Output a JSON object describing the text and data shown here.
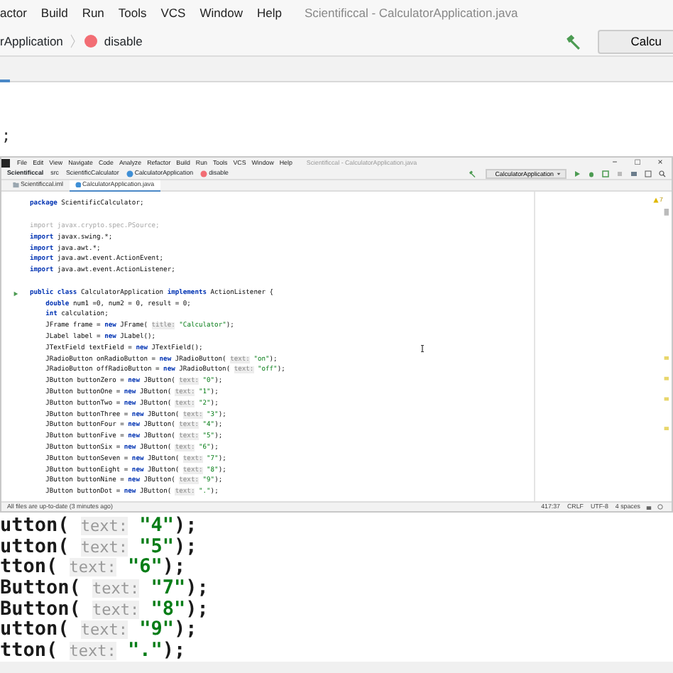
{
  "main_window": {
    "menu": [
      "actor",
      "Build",
      "Run",
      "Tools",
      "VCS",
      "Window",
      "Help"
    ],
    "title": "Scientificcal - CalculatorApplication.java",
    "breadcrumbs": [
      {
        "kind": "text",
        "text": "rApplication"
      },
      {
        "kind": "method",
        "text": "disable"
      }
    ],
    "run_config": "Calcu",
    "line_fragment": ";",
    "code": [
      {
        "segments": [
          {
            "kind": "plain",
            "text": "utton( "
          },
          {
            "kind": "hint",
            "text": "text:"
          },
          {
            "kind": "string",
            "text": " \"4\""
          },
          {
            "kind": "plain",
            "text": ");"
          }
        ]
      },
      {
        "segments": [
          {
            "kind": "plain",
            "text": "utton( "
          },
          {
            "kind": "hint",
            "text": "text:"
          },
          {
            "kind": "string",
            "text": " \"5\""
          },
          {
            "kind": "plain",
            "text": ");"
          }
        ]
      },
      {
        "segments": [
          {
            "kind": "plain",
            "text": "tton( "
          },
          {
            "kind": "hint",
            "text": "text:"
          },
          {
            "kind": "string",
            "text": " \"6\""
          },
          {
            "kind": "plain",
            "text": ");"
          }
        ]
      },
      {
        "segments": [
          {
            "kind": "plain",
            "text": "Button( "
          },
          {
            "kind": "hint",
            "text": "text:"
          },
          {
            "kind": "string",
            "text": " \"7\""
          },
          {
            "kind": "plain",
            "text": ");"
          }
        ]
      },
      {
        "segments": [
          {
            "kind": "plain",
            "text": "Button( "
          },
          {
            "kind": "hint",
            "text": "text:"
          },
          {
            "kind": "string",
            "text": " \"8\""
          },
          {
            "kind": "plain",
            "text": ");"
          }
        ]
      },
      {
        "segments": [
          {
            "kind": "plain",
            "text": "utton( "
          },
          {
            "kind": "hint",
            "text": "text:"
          },
          {
            "kind": "string",
            "text": " \"9\""
          },
          {
            "kind": "plain",
            "text": ");"
          }
        ]
      },
      {
        "segments": [
          {
            "kind": "plain",
            "text": "tton( "
          },
          {
            "kind": "hint",
            "text": "text:"
          },
          {
            "kind": "string",
            "text": " \".\""
          },
          {
            "kind": "plain",
            "text": ");"
          }
        ]
      }
    ]
  },
  "inner_window": {
    "menu": [
      "File",
      "Edit",
      "View",
      "Navigate",
      "Code",
      "Analyze",
      "Refactor",
      "Build",
      "Run",
      "Tools",
      "VCS",
      "Window",
      "Help"
    ],
    "title": "Scientificcal - CalculatorApplication.java",
    "window_controls": [
      "−",
      "□",
      "×"
    ],
    "breadcrumbs": [
      {
        "kind": "text",
        "text": "Scientificcal"
      },
      {
        "kind": "text",
        "text": "src"
      },
      {
        "kind": "text",
        "text": "ScientificCalculator"
      },
      {
        "kind": "class",
        "text": "CalculatorApplication"
      },
      {
        "kind": "method",
        "text": "disable"
      }
    ],
    "run_config": "CalculatorApplication",
    "tabs": [
      {
        "kind": "module",
        "label": "Scientificcal.iml",
        "selected": false
      },
      {
        "kind": "class",
        "label": "CalculatorApplication.java",
        "selected": true
      }
    ],
    "warnings": "7",
    "code": [
      {
        "kind": "code",
        "run_marker": false,
        "segments": [
          {
            "kind": "keyword",
            "text": "package "
          },
          {
            "kind": "plain",
            "text": "ScientificCalculator;"
          }
        ]
      },
      {
        "kind": "blank"
      },
      {
        "kind": "code",
        "run_marker": false,
        "segments": [
          {
            "kind": "unused",
            "text": "import javax.crypto.spec.PSource;"
          }
        ]
      },
      {
        "kind": "code",
        "run_marker": false,
        "segments": [
          {
            "kind": "keyword",
            "text": "import "
          },
          {
            "kind": "plain",
            "text": "javax.swing.*;"
          }
        ]
      },
      {
        "kind": "code",
        "run_marker": false,
        "segments": [
          {
            "kind": "keyword",
            "text": "import "
          },
          {
            "kind": "plain",
            "text": "java.awt.*;"
          }
        ]
      },
      {
        "kind": "code",
        "run_marker": false,
        "segments": [
          {
            "kind": "keyword",
            "text": "import "
          },
          {
            "kind": "plain",
            "text": "java.awt.event.ActionEvent;"
          }
        ]
      },
      {
        "kind": "code",
        "run_marker": false,
        "segments": [
          {
            "kind": "keyword",
            "text": "import "
          },
          {
            "kind": "plain",
            "text": "java.awt.event.ActionListener;"
          }
        ]
      },
      {
        "kind": "blank"
      },
      {
        "kind": "code",
        "run_marker": true,
        "segments": [
          {
            "kind": "keyword",
            "text": "public class "
          },
          {
            "kind": "plain",
            "text": "CalculatorApplication "
          },
          {
            "kind": "keyword",
            "text": "implements "
          },
          {
            "kind": "plain",
            "text": "ActionListener {"
          }
        ]
      },
      {
        "kind": "code",
        "run_marker": false,
        "segments": [
          {
            "kind": "keyword",
            "text": "    double "
          },
          {
            "kind": "plain",
            "text": "num1 =0, num2 = 0, result = 0;"
          }
        ]
      },
      {
        "kind": "code",
        "run_marker": false,
        "segments": [
          {
            "kind": "keyword",
            "text": "    int "
          },
          {
            "kind": "plain",
            "text": "calculation;"
          }
        ]
      },
      {
        "kind": "code",
        "run_marker": false,
        "segments": [
          {
            "kind": "plain",
            "text": "    JFrame frame = "
          },
          {
            "kind": "keyword",
            "text": "new "
          },
          {
            "kind": "plain",
            "text": "JFrame( "
          },
          {
            "kind": "hint",
            "text": "title:"
          },
          {
            "kind": "string",
            "text": " \"Calculator\""
          },
          {
            "kind": "plain",
            "text": ");"
          }
        ]
      },
      {
        "kind": "code",
        "run_marker": false,
        "segments": [
          {
            "kind": "plain",
            "text": "    JLabel label = "
          },
          {
            "kind": "keyword",
            "text": "new "
          },
          {
            "kind": "plain",
            "text": "JLabel();"
          }
        ]
      },
      {
        "kind": "code",
        "run_marker": false,
        "segments": [
          {
            "kind": "plain",
            "text": "    JTextField textField = "
          },
          {
            "kind": "keyword",
            "text": "new "
          },
          {
            "kind": "plain",
            "text": "JTextField();"
          }
        ]
      },
      {
        "kind": "code",
        "run_marker": false,
        "segments": [
          {
            "kind": "plain",
            "text": "    JRadioButton onRadioButton = "
          },
          {
            "kind": "keyword",
            "text": "new "
          },
          {
            "kind": "plain",
            "text": "JRadioButton( "
          },
          {
            "kind": "hint",
            "text": "text:"
          },
          {
            "kind": "string",
            "text": " \"on\""
          },
          {
            "kind": "plain",
            "text": ");"
          }
        ]
      },
      {
        "kind": "code",
        "run_marker": false,
        "segments": [
          {
            "kind": "plain",
            "text": "    JRadioButton offRadioButton = "
          },
          {
            "kind": "keyword",
            "text": "new "
          },
          {
            "kind": "plain",
            "text": "JRadioButton( "
          },
          {
            "kind": "hint",
            "text": "text:"
          },
          {
            "kind": "string",
            "text": " \"off\""
          },
          {
            "kind": "plain",
            "text": ");"
          }
        ]
      },
      {
        "kind": "code",
        "run_marker": false,
        "segments": [
          {
            "kind": "plain",
            "text": "    JButton buttonZero = "
          },
          {
            "kind": "keyword",
            "text": "new "
          },
          {
            "kind": "plain",
            "text": "JButton( "
          },
          {
            "kind": "hint",
            "text": "text:"
          },
          {
            "kind": "string",
            "text": " \"0\""
          },
          {
            "kind": "plain",
            "text": ");"
          }
        ]
      },
      {
        "kind": "code",
        "run_marker": false,
        "segments": [
          {
            "kind": "plain",
            "text": "    JButton buttonOne = "
          },
          {
            "kind": "keyword",
            "text": "new "
          },
          {
            "kind": "plain",
            "text": "JButton( "
          },
          {
            "kind": "hint",
            "text": "text:"
          },
          {
            "kind": "string",
            "text": " \"1\""
          },
          {
            "kind": "plain",
            "text": ");"
          }
        ]
      },
      {
        "kind": "code",
        "run_marker": false,
        "segments": [
          {
            "kind": "plain",
            "text": "    JButton buttonTwo = "
          },
          {
            "kind": "keyword",
            "text": "new "
          },
          {
            "kind": "plain",
            "text": "JButton( "
          },
          {
            "kind": "hint",
            "text": "text:"
          },
          {
            "kind": "string",
            "text": " \"2\""
          },
          {
            "kind": "plain",
            "text": ");"
          }
        ]
      },
      {
        "kind": "code",
        "run_marker": false,
        "segments": [
          {
            "kind": "plain",
            "text": "    JButton buttonThree = "
          },
          {
            "kind": "keyword",
            "text": "new "
          },
          {
            "kind": "plain",
            "text": "JButton( "
          },
          {
            "kind": "hint",
            "text": "text:"
          },
          {
            "kind": "string",
            "text": " \"3\""
          },
          {
            "kind": "plain",
            "text": ");"
          }
        ]
      },
      {
        "kind": "code",
        "run_marker": false,
        "segments": [
          {
            "kind": "plain",
            "text": "    JButton buttonFour = "
          },
          {
            "kind": "keyword",
            "text": "new "
          },
          {
            "kind": "plain",
            "text": "JButton( "
          },
          {
            "kind": "hint",
            "text": "text:"
          },
          {
            "kind": "string",
            "text": " \"4\""
          },
          {
            "kind": "plain",
            "text": ");"
          }
        ]
      },
      {
        "kind": "code",
        "run_marker": false,
        "segments": [
          {
            "kind": "plain",
            "text": "    JButton buttonFive = "
          },
          {
            "kind": "keyword",
            "text": "new "
          },
          {
            "kind": "plain",
            "text": "JButton( "
          },
          {
            "kind": "hint",
            "text": "text:"
          },
          {
            "kind": "string",
            "text": " \"5\""
          },
          {
            "kind": "plain",
            "text": ");"
          }
        ]
      },
      {
        "kind": "code",
        "run_marker": false,
        "segments": [
          {
            "kind": "plain",
            "text": "    JButton buttonSix = "
          },
          {
            "kind": "keyword",
            "text": "new "
          },
          {
            "kind": "plain",
            "text": "JButton( "
          },
          {
            "kind": "hint",
            "text": "text:"
          },
          {
            "kind": "string",
            "text": " \"6\""
          },
          {
            "kind": "plain",
            "text": ");"
          }
        ]
      },
      {
        "kind": "code",
        "run_marker": false,
        "segments": [
          {
            "kind": "plain",
            "text": "    JButton buttonSeven = "
          },
          {
            "kind": "keyword",
            "text": "new "
          },
          {
            "kind": "plain",
            "text": "JButton( "
          },
          {
            "kind": "hint",
            "text": "text:"
          },
          {
            "kind": "string",
            "text": " \"7\""
          },
          {
            "kind": "plain",
            "text": ");"
          }
        ]
      },
      {
        "kind": "code",
        "run_marker": false,
        "segments": [
          {
            "kind": "plain",
            "text": "    JButton buttonEight = "
          },
          {
            "kind": "keyword",
            "text": "new "
          },
          {
            "kind": "plain",
            "text": "JButton( "
          },
          {
            "kind": "hint",
            "text": "text:"
          },
          {
            "kind": "string",
            "text": " \"8\""
          },
          {
            "kind": "plain",
            "text": ");"
          }
        ]
      },
      {
        "kind": "code",
        "run_marker": false,
        "segments": [
          {
            "kind": "plain",
            "text": "    JButton buttonNine = "
          },
          {
            "kind": "keyword",
            "text": "new "
          },
          {
            "kind": "plain",
            "text": "JButton( "
          },
          {
            "kind": "hint",
            "text": "text:"
          },
          {
            "kind": "string",
            "text": " \"9\""
          },
          {
            "kind": "plain",
            "text": ");"
          }
        ]
      },
      {
        "kind": "code",
        "run_marker": false,
        "segments": [
          {
            "kind": "plain",
            "text": "    JButton buttonDot = "
          },
          {
            "kind": "keyword",
            "text": "new "
          },
          {
            "kind": "plain",
            "text": "JButton( "
          },
          {
            "kind": "hint",
            "text": "text:"
          },
          {
            "kind": "string",
            "text": " \".\""
          },
          {
            "kind": "plain",
            "text": ");"
          }
        ]
      }
    ],
    "status": {
      "message": "All files are up-to-date (3 minutes ago)",
      "position": "417:37",
      "line_separator": "CRLF",
      "encoding": "UTF-8",
      "indent": "4 spaces"
    }
  }
}
